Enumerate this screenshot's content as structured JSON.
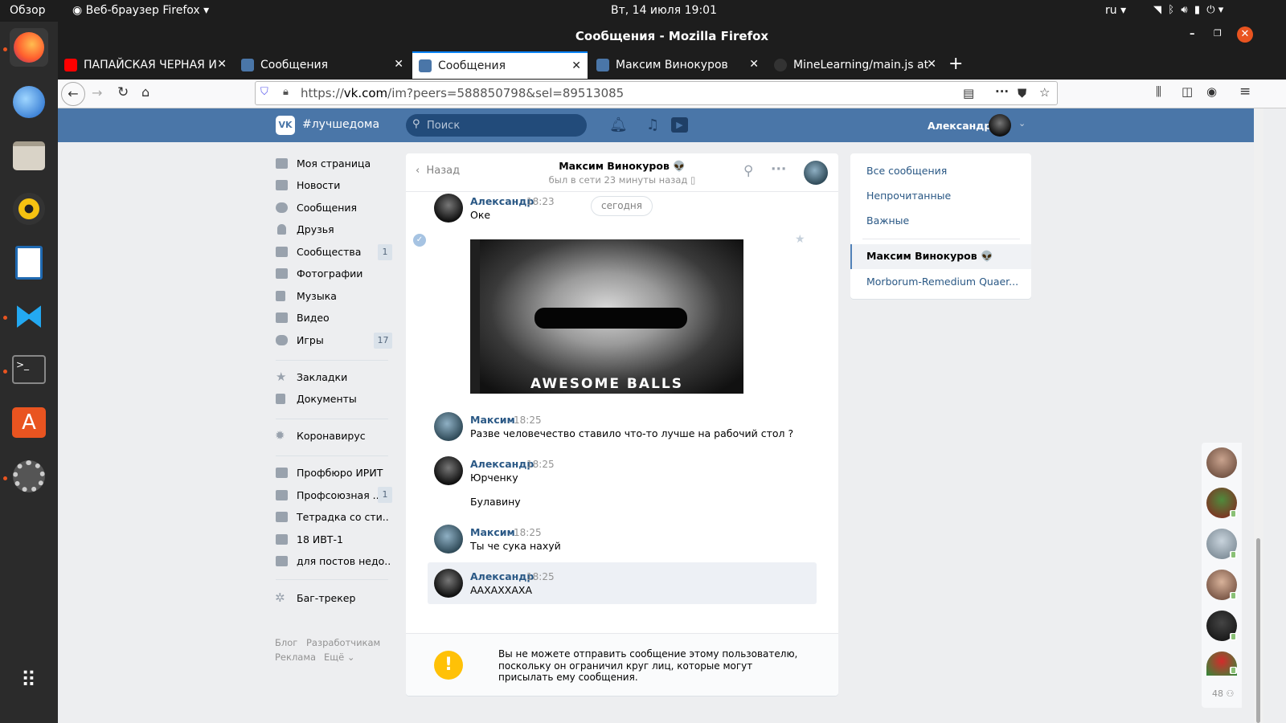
{
  "system_bar": {
    "overview": "Обзор",
    "app_menu": "Веб-браузер Firefox",
    "datetime": "Вт, 14 июля  19:01",
    "lang": "ru"
  },
  "window": {
    "title": "Сообщения - Mozilla Firefox"
  },
  "tabs": [
    {
      "label": "ПАПАЙСКАЯ ЧЕРНАЯ И",
      "color": "#ff0000"
    },
    {
      "label": "Сообщения",
      "color": "#4a76a8"
    },
    {
      "label": "Сообщения",
      "color": "#4a76a8",
      "active": true
    },
    {
      "label": "Максим Винокуров",
      "color": "#4a76a8"
    },
    {
      "label": "MineLearning/main.js at",
      "color": "#333333"
    }
  ],
  "url": {
    "prefix": "https://",
    "domain": "vk.com",
    "path": "/im?peers=588850798&sel=89513085"
  },
  "vk": {
    "logo_text": "#лучшедома",
    "search_placeholder": "Поиск",
    "user_name": "Александр",
    "accent": "#4a76a8"
  },
  "menu": {
    "main": [
      {
        "label": "Моя страница",
        "icon": "home-icon"
      },
      {
        "label": "Новости",
        "icon": "news-icon"
      },
      {
        "label": "Сообщения",
        "icon": "chat-icon"
      },
      {
        "label": "Друзья",
        "icon": "friend-icon"
      },
      {
        "label": "Сообщества",
        "icon": "groups-icon",
        "count": "1"
      },
      {
        "label": "Фотографии",
        "icon": "camera-icon"
      },
      {
        "label": "Музыка",
        "icon": "music-icon"
      },
      {
        "label": "Видео",
        "icon": "video-icon"
      },
      {
        "label": "Игры",
        "icon": "games-icon",
        "count": "17"
      }
    ],
    "extra": [
      {
        "label": "Закладки",
        "icon": "star-icon"
      },
      {
        "label": "Документы",
        "icon": "doc-icon"
      }
    ],
    "covid": "Коронавирус",
    "groups": [
      {
        "label": "Профбюро ИРИТ"
      },
      {
        "label": "Профсоюзная ...",
        "count": "1"
      },
      {
        "label": "Тетрадка со сти.."
      },
      {
        "label": "18 ИВТ-1"
      },
      {
        "label": "для постов недо.."
      }
    ],
    "bugtracker": "Баг-трекер",
    "footer": {
      "blog": "Блог",
      "dev": "Разработчикам",
      "ads": "Реклама",
      "more": "Ещё ⌄"
    }
  },
  "chat": {
    "back": "Назад",
    "peer_name": "Максим Винокуров 👽",
    "peer_status": "был в сети 23 минуты назад",
    "date_pill": "сегодня",
    "image_caption": "AWESOME BALLS",
    "messages": [
      {
        "author": "Александр",
        "time": "18:23",
        "lines": [
          "Оке"
        ]
      },
      {
        "author": "Максим",
        "time": "18:25",
        "lines": [
          "Разве человечество ставило что-то лучше на рабочий стол ?"
        ]
      },
      {
        "author": "Александр",
        "time": "18:25",
        "lines": [
          "Юрченку",
          "Булавину"
        ]
      },
      {
        "author": "Максим",
        "time": "18:25",
        "lines": [
          "Ты че сука нахуй"
        ]
      },
      {
        "author": "Александр",
        "time": "18:25",
        "lines": [
          "ААХАХХАХА"
        ]
      }
    ],
    "notice": "Вы не можете отправить сообщение этому пользователю, поскольку он ограничил круг лиц, которые могут присылать ему сообщения."
  },
  "right_panel": {
    "filters": [
      "Все сообщения",
      "Непрочитанные",
      "Важные"
    ],
    "conversations": [
      "Максим Винокуров 👽",
      "Morborum-Remedium Quaer..."
    ]
  },
  "friends_online_count": "48"
}
